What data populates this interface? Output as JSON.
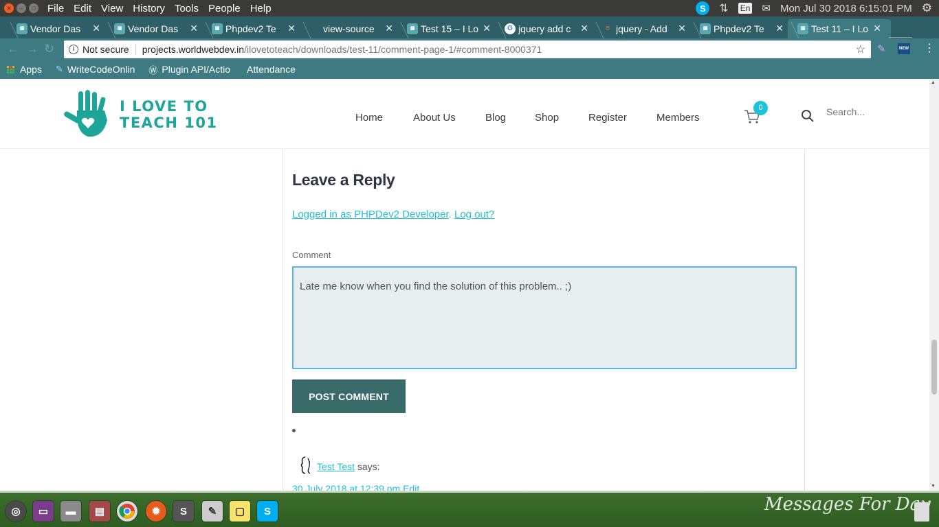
{
  "os": {
    "menu": [
      "File",
      "Edit",
      "View",
      "History",
      "Tools",
      "People",
      "Help"
    ],
    "lang": "En",
    "clock": "Mon Jul 30 2018  6:15:01 PM"
  },
  "tabs": [
    {
      "title": "Vendor Das",
      "active": false
    },
    {
      "title": "Vendor Das",
      "active": false
    },
    {
      "title": "Phpdev2 Te",
      "active": false
    },
    {
      "title": "view-source",
      "active": false
    },
    {
      "title": "Test 15 – I Lo",
      "active": false
    },
    {
      "title": "jquery add c",
      "active": false
    },
    {
      "title": "jquery - Add",
      "active": false
    },
    {
      "title": "Phpdev2 Te",
      "active": false
    },
    {
      "title": "Test 11 – I Lo",
      "active": true
    }
  ],
  "address": {
    "security": "Not secure",
    "host": "projects.worldwebdev.in",
    "path": "/ilovetoteach/downloads/test-11/comment-page-1/#comment-8000371"
  },
  "bookmarks": [
    "Apps",
    "WriteCodeOnlin",
    "Plugin API/Actio",
    "Attendance"
  ],
  "site": {
    "logo_line1": "I LOVE TO",
    "logo_line2": "TEACH 101",
    "nav": [
      "Home",
      "About Us",
      "Blog",
      "Shop",
      "Register",
      "Members"
    ],
    "cart_count": "0",
    "search_placeholder": "Search..."
  },
  "reply": {
    "title": "Leave a Reply",
    "logged_in": "Logged in as PHPDev2 Developer",
    "dot": ".",
    "logout": "Log out?",
    "comment_label": "Comment",
    "comment_value": "Late me know when you find the solution of this problem.. ;)",
    "post_button": "POST COMMENT"
  },
  "comment": {
    "author": "Test Test",
    "says": "says:",
    "date": "30 July 2018 at 12:39 pm",
    "edit": "Edit"
  },
  "dock": {
    "wallpaper_text": "Messages For Day"
  },
  "colors": {
    "accent": "#1ec3d8",
    "brand": "#1da59a",
    "button": "#3a6b6b",
    "chrome": "#3d7a82"
  }
}
